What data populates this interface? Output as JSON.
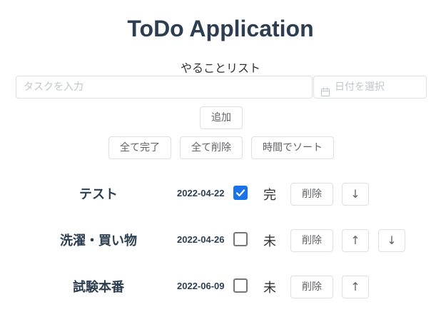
{
  "app": {
    "title": "ToDo Application",
    "subtitle": "やることリスト"
  },
  "form": {
    "task_placeholder": "タスクを入力",
    "date_placeholder": "日付を選択",
    "add_label": "追加"
  },
  "actions": {
    "complete_all": "全て完了",
    "delete_all": "全て削除",
    "sort_by_time": "時間でソート"
  },
  "tasks": [
    {
      "name": "テスト",
      "date": "2022-04-22",
      "done": true,
      "status": "完",
      "delete_label": "削除",
      "up": "",
      "down": "↓"
    },
    {
      "name": "洗濯・買い物",
      "date": "2022-04-26",
      "done": false,
      "status": "未",
      "delete_label": "削除",
      "up": "↑",
      "down": "↓"
    },
    {
      "name": "試験本番",
      "date": "2022-06-09",
      "done": false,
      "status": "未",
      "delete_label": "削除",
      "up": "↑",
      "down": ""
    }
  ],
  "colors": {
    "accent": "#1a73e8",
    "text": "#2c3e50",
    "border": "#dcdfe6"
  }
}
